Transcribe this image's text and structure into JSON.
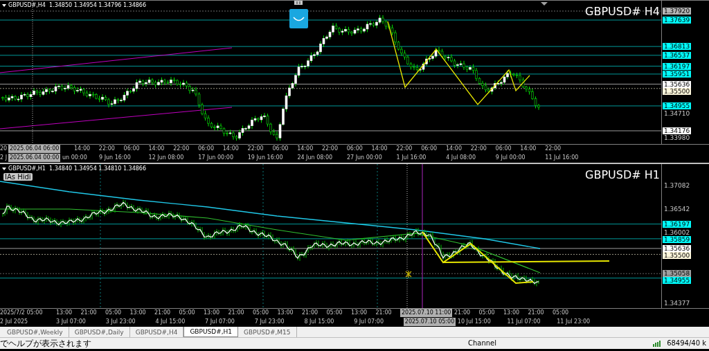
{
  "panes": [
    {
      "header": "GBPUSD#,H4  1.34850 1.34954 1.34796 1.34866",
      "symbol": "GBPUSD# H4",
      "price_labels": [
        {
          "text": "1.37920",
          "kind": "dotted",
          "color": "#b4b4b4"
        },
        {
          "text": "1.37639",
          "kind": "solid",
          "color": "#00ffff"
        },
        {
          "text": "1.36813",
          "kind": "solid",
          "color": "#00ffff"
        },
        {
          "text": "1.36537",
          "kind": "solid",
          "color": "#00ffff"
        },
        {
          "text": "1.36197",
          "kind": "solid",
          "color": "#00ffff"
        },
        {
          "text": "1.35951",
          "kind": "solid",
          "color": "#00ffff"
        },
        {
          "text": "1.35636",
          "kind": "solid",
          "color": "#ffffff"
        },
        {
          "text": "1.35500",
          "kind": "dotted",
          "color": "#fff8dc"
        },
        {
          "text": "1.34955",
          "kind": "solid",
          "color": "#00ffff"
        },
        {
          "text": "1.34710",
          "kind": "plain"
        },
        {
          "text": "1.34176",
          "kind": "solid",
          "color": "#ffffff"
        },
        {
          "text": "1.33980",
          "kind": "plain"
        }
      ],
      "time_rows": [
        [
          {
            "text": "20",
            "kind": "edge"
          },
          {
            "text": "2025.06.04 06:00",
            "kind": "cursor"
          },
          {
            "text": "14:00",
            "kind": "tick"
          },
          {
            "text": "22:00",
            "kind": "tick"
          },
          {
            "text": "06:00",
            "kind": "tick"
          },
          {
            "text": "14:00",
            "kind": "tick"
          },
          {
            "text": "22:00",
            "kind": "tick"
          },
          {
            "text": "06:00",
            "kind": "tick"
          },
          {
            "text": "14:00",
            "kind": "tick"
          },
          {
            "text": "22:00",
            "kind": "tick"
          },
          {
            "text": "06:00",
            "kind": "tick"
          },
          {
            "text": "14:00",
            "kind": "tick"
          },
          {
            "text": "22:00",
            "kind": "tick"
          },
          {
            "text": "06:00",
            "kind": "tick"
          },
          {
            "text": "14:00",
            "kind": "tick"
          },
          {
            "text": "22:00",
            "kind": "tick"
          },
          {
            "text": "06:00",
            "kind": "tick"
          },
          {
            "text": "14:00",
            "kind": "tick"
          },
          {
            "text": "22:00",
            "kind": "tick"
          },
          {
            "text": "06:00",
            "kind": "tick"
          },
          {
            "text": "14:00",
            "kind": "tick"
          },
          {
            "text": "22:00",
            "kind": "tick"
          }
        ],
        [
          {
            "text": "2 J",
            "kind": "edge"
          },
          {
            "text": "2025.06.04 00:00",
            "kind": "cursor"
          },
          {
            "text": "un 00:00",
            "kind": "partial"
          },
          {
            "text": "9 Jun 16:00",
            "kind": "tick"
          },
          {
            "text": "12 Jun 08:00",
            "kind": "tick"
          },
          {
            "text": "17 Jun 00:00",
            "kind": "tick"
          },
          {
            "text": "19 Jun 16:00",
            "kind": "tick"
          },
          {
            "text": "24 Jun 08:00",
            "kind": "tick"
          },
          {
            "text": "27 Jun 00:00",
            "kind": "tick"
          },
          {
            "text": "1 Jul 16:00",
            "kind": "tick"
          },
          {
            "text": "4 Jul 08:00",
            "kind": "tick"
          },
          {
            "text": "9 Jul 00:00",
            "kind": "tick"
          },
          {
            "text": "11 Jul 16:00",
            "kind": "tick"
          }
        ]
      ]
    },
    {
      "header": "GBPUSD#,H1  1.34840 1.34954 1.34810 1.34866",
      "symbol": "GBPUSD# H1",
      "badge": "IAs Hidi",
      "price_labels": [
        {
          "text": "1.37082",
          "kind": "plain"
        },
        {
          "text": "1.36542",
          "kind": "plain"
        },
        {
          "text": "1.36197",
          "kind": "solid",
          "color": "#00ffff"
        },
        {
          "text": "1.36002",
          "kind": "plain"
        },
        {
          "text": "1.35859",
          "kind": "solid",
          "color": "#00ffff"
        },
        {
          "text": "1.35636",
          "kind": "solid",
          "color": "#ffffff"
        },
        {
          "text": "1.35500",
          "kind": "dotted",
          "color": "#fff8dc"
        },
        {
          "text": "1.35058",
          "kind": "dotted",
          "color": "#a0a0a0"
        },
        {
          "text": "1.34955",
          "kind": "solid",
          "color": "#00ffff"
        },
        {
          "text": "1.34377",
          "kind": "plain"
        }
      ],
      "time_rows": [
        [
          {
            "text": "2025/7/2 05:00",
            "kind": "edge"
          },
          {
            "text": "13:00",
            "kind": "tick"
          },
          {
            "text": "21:00",
            "kind": "tick"
          },
          {
            "text": "05:00",
            "kind": "tick"
          },
          {
            "text": "13:00",
            "kind": "tick"
          },
          {
            "text": "21:00",
            "kind": "tick"
          },
          {
            "text": "05:00",
            "kind": "tick"
          },
          {
            "text": "13:00",
            "kind": "tick"
          },
          {
            "text": "21:00",
            "kind": "tick"
          },
          {
            "text": "05:00",
            "kind": "tick"
          },
          {
            "text": "13:00",
            "kind": "tick"
          },
          {
            "text": "21:00",
            "kind": "tick"
          },
          {
            "text": "05:00",
            "kind": "tick"
          },
          {
            "text": "13:00",
            "kind": "tick"
          },
          {
            "text": "21:00",
            "kind": "tick"
          },
          {
            "text": "2025.07.10 11:00",
            "kind": "cursor"
          },
          {
            "text": "21:00",
            "kind": "tick"
          },
          {
            "text": "05:00",
            "kind": "tick"
          },
          {
            "text": "13:00",
            "kind": "tick"
          },
          {
            "text": "21:00",
            "kind": "tick"
          },
          {
            "text": "05:00",
            "kind": "tick"
          }
        ],
        [
          {
            "text": "2 Jul 2025",
            "kind": "edge"
          },
          {
            "text": "3 Jul 07:00",
            "kind": "tick"
          },
          {
            "text": "3 Jul 23:00",
            "kind": "tick"
          },
          {
            "text": "4 Jul 15:00",
            "kind": "tick"
          },
          {
            "text": "7 Jul 07:00",
            "kind": "tick"
          },
          {
            "text": "7 Jul 23:00",
            "kind": "tick"
          },
          {
            "text": "8 Jul 15:00",
            "kind": "tick"
          },
          {
            "text": "9 Jul 07:00",
            "kind": "tick"
          },
          {
            "text": "2025.07.10 05:00",
            "kind": "cursor"
          },
          {
            "text": "10 Jul 15:00",
            "kind": "tick"
          },
          {
            "text": "11 Jul 07:00",
            "kind": "tick"
          },
          {
            "text": "11 Jul 23:00",
            "kind": "tick"
          }
        ]
      ]
    }
  ],
  "tabs": [
    {
      "label": "GBPUSD#,Weekly",
      "selected": false
    },
    {
      "label": "GBPUSD#,Daily",
      "selected": false
    },
    {
      "label": "GBPUSD#,H4",
      "selected": false
    },
    {
      "label": "GBPUSD#,H1",
      "selected": true
    },
    {
      "label": "GBPUSD#,M15",
      "selected": false
    }
  ],
  "status_bar": {
    "help": "でヘルプが表示されます",
    "channel": "Channel",
    "traffic": "68494/40 k"
  }
}
